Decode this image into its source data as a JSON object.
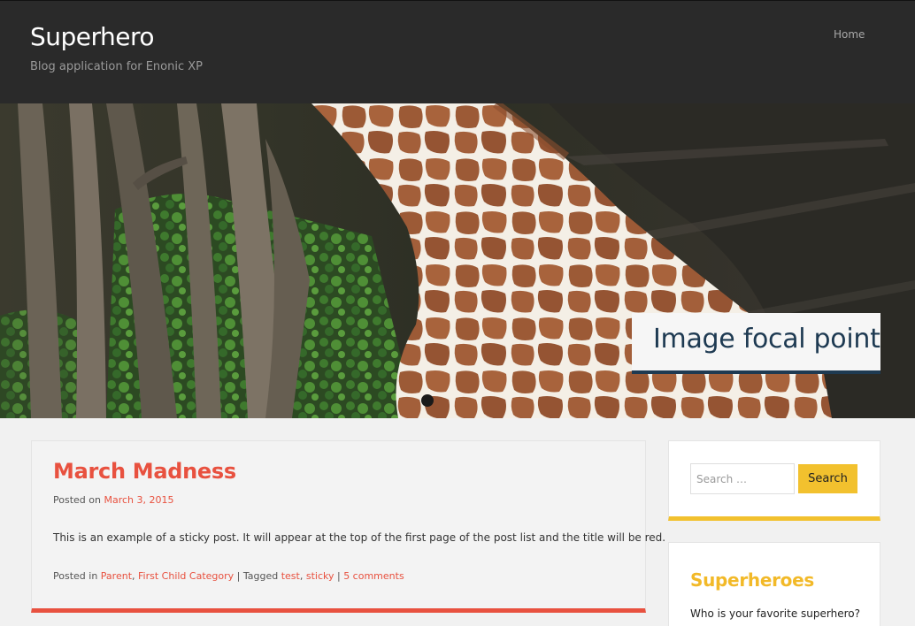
{
  "header": {
    "site_title": "Superhero",
    "site_description": "Blog application for Enonic XP",
    "nav": {
      "home_label": "Home"
    }
  },
  "hero": {
    "caption": "Image focal point",
    "colors": {
      "caption_text": "#1e3a52",
      "caption_bg": "#f6f6f6"
    }
  },
  "post": {
    "title": "March Madness",
    "posted_on_label": "Posted on",
    "date": "March 3, 2015",
    "excerpt": "This is an example of a sticky post. It will appear at the top of the first page of the post list and the title will be red.",
    "posted_in_label": "Posted in",
    "categories": [
      "Parent",
      "First Child Category"
    ],
    "tagged_label": "Tagged",
    "tags": [
      "test",
      "sticky"
    ],
    "comments_label": "5 comments",
    "accent_color": "#e8513f"
  },
  "sidebar": {
    "search": {
      "placeholder": "Search …",
      "button_label": "Search",
      "accent_color": "#f2c12e"
    },
    "superheroes": {
      "title": "Superheroes",
      "text": "Who is your favorite superhero?"
    }
  }
}
